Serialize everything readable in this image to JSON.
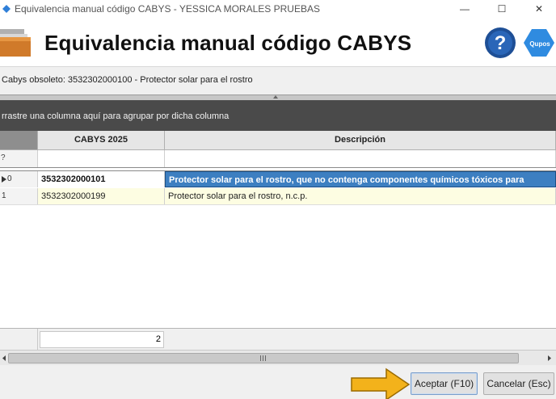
{
  "window": {
    "title": "Equivalencia manual código CABYS - YESSICA MORALES PRUEBAS",
    "minimize_glyph": "—",
    "maximize_glyph": "☐",
    "close_glyph": "✕",
    "app_icon": "qupos-icon"
  },
  "header": {
    "title": "Equivalencia manual código CABYS",
    "left_icon": "folder-icon",
    "help_icon": "help-icon",
    "brand_icon": "qupos-logo-icon",
    "brand_text": "Qupos"
  },
  "info": {
    "obsolete_label": "Cabys obsoleto: 3532302000100 - Protector solar para el rostro"
  },
  "group_panel": {
    "text": "rrastre una columna aquí para agrupar por dicha columna"
  },
  "grid": {
    "columns": [
      "CABYS 2025",
      "Descripción"
    ],
    "filter_indicator": "?",
    "rows": [
      {
        "indicator": "0",
        "cabys": "3532302000101",
        "descripcion": "Protector solar para el rostro, que no contenga componentes químicos tóxicos para",
        "selected": true
      },
      {
        "indicator": "1",
        "cabys": "3532302000199",
        "descripcion": "Protector solar para el rostro, n.c.p.",
        "selected": false
      }
    ],
    "summary_count": "2"
  },
  "buttons": {
    "accept": "Aceptar (F10)",
    "cancel": "Cancelar (Esc)"
  },
  "colors": {
    "selected_row": "#3d7fc1",
    "alt_row": "#fdfde2",
    "group_panel": "#4a4a4a",
    "arrow_annotation": "#f3b21b"
  }
}
